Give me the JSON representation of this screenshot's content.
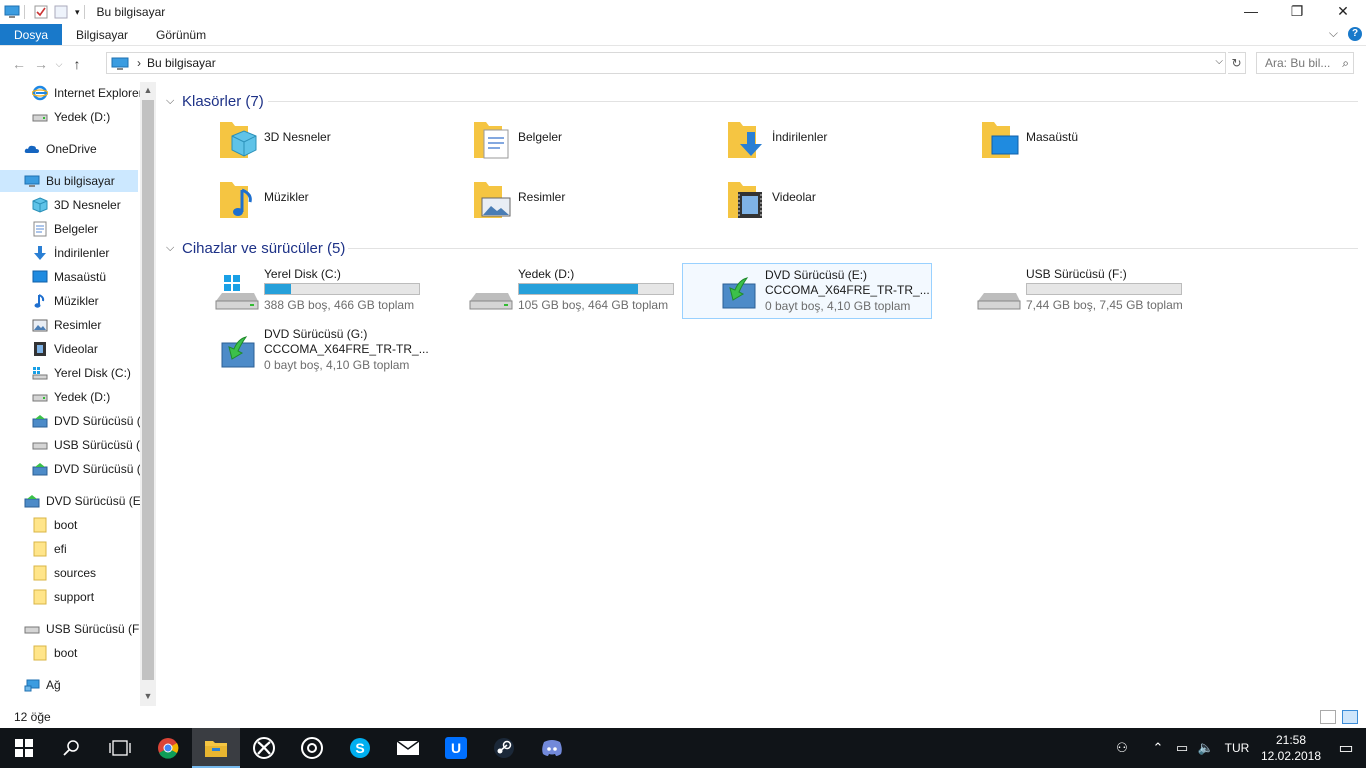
{
  "window": {
    "title": "Bu bilgisayar",
    "min_glyph": "—",
    "max_glyph": "❐",
    "close_glyph": "✕"
  },
  "ribbon": {
    "tabs": [
      "Dosya",
      "Bilgisayar",
      "Görünüm"
    ],
    "help_glyph": "?",
    "expand_glyph": "⌵"
  },
  "nav": {
    "back_glyph": "←",
    "forward_glyph": "→",
    "up_glyph": "↑",
    "recent_glyph": "⌵"
  },
  "address": {
    "path": "Bu bilgisayar",
    "sep_glyph": "›",
    "dropdown_glyph": "⌵",
    "refresh_glyph": "↻"
  },
  "search": {
    "placeholder": "Ara: Bu bil...",
    "icon_glyph": "⌕"
  },
  "sidebar": {
    "items": [
      {
        "label": "Internet Explorer",
        "icon": "internet-explorer-icon"
      },
      {
        "label": "Yedek (D:)",
        "icon": "drive-icon"
      },
      {
        "label": "OneDrive",
        "icon": "onedrive-icon"
      },
      {
        "label": "Bu bilgisayar",
        "icon": "computer-icon"
      },
      {
        "label": "3D Nesneler",
        "icon": "3d-objects-icon"
      },
      {
        "label": "Belgeler",
        "icon": "documents-icon"
      },
      {
        "label": "İndirilenler",
        "icon": "downloads-icon"
      },
      {
        "label": "Masaüstü",
        "icon": "desktop-icon"
      },
      {
        "label": "Müzikler",
        "icon": "music-icon"
      },
      {
        "label": "Resimler",
        "icon": "pictures-icon"
      },
      {
        "label": "Videolar",
        "icon": "videos-icon"
      },
      {
        "label": "Yerel Disk (C:)",
        "icon": "windows-drive-icon"
      },
      {
        "label": "Yedek (D:)",
        "icon": "drive-icon"
      },
      {
        "label": "DVD Sürücüsü (E",
        "icon": "dvd-icon"
      },
      {
        "label": "USB Sürücüsü (F",
        "icon": "usb-drive-icon"
      },
      {
        "label": "DVD Sürücüsü (G",
        "icon": "dvd-icon"
      },
      {
        "label": "DVD Sürücüsü (E:)",
        "icon": "dvd-icon"
      },
      {
        "label": "boot",
        "icon": "folder-icon"
      },
      {
        "label": "efi",
        "icon": "folder-icon"
      },
      {
        "label": "sources",
        "icon": "folder-icon"
      },
      {
        "label": "support",
        "icon": "folder-icon"
      },
      {
        "label": "USB Sürücüsü (F:)",
        "icon": "usb-drive-icon"
      },
      {
        "label": "boot",
        "icon": "folder-icon"
      },
      {
        "label": "Ağ",
        "icon": "network-icon"
      }
    ],
    "scroll_up_glyph": "▲",
    "scroll_down_glyph": "▼"
  },
  "groups": {
    "folders": {
      "title": "Klasörler (7)",
      "items": [
        {
          "name": "3D Nesneler"
        },
        {
          "name": "Belgeler"
        },
        {
          "name": "İndirilenler"
        },
        {
          "name": "Masaüstü"
        },
        {
          "name": "Müzikler"
        },
        {
          "name": "Resimler"
        },
        {
          "name": "Videolar"
        }
      ]
    },
    "drives": {
      "title": "Cihazlar ve sürücüler (5)",
      "items": [
        {
          "name": "Yerel Disk (C:)",
          "info": "388 GB boş, 466 GB toplam",
          "used_fraction": 0.167
        },
        {
          "name": "Yedek (D:)",
          "info": "105 GB boş, 464 GB toplam",
          "used_fraction": 0.774
        },
        {
          "name": "DVD Sürücüsü (E:)",
          "sub": "CCCOMA_X64FRE_TR-TR_...",
          "info": "0 bayt boş, 4,10 GB toplam"
        },
        {
          "name": "USB Sürücüsü (F:)",
          "info": "7,44 GB boş, 7,45 GB toplam",
          "used_fraction": 0.0
        },
        {
          "name": "DVD Sürücüsü (G:)",
          "sub": "CCCOMA_X64FRE_TR-TR_...",
          "info": "0 bayt boş, 4,10 GB toplam"
        }
      ]
    },
    "chevron_glyph": "⌵"
  },
  "status": {
    "count": "12 öğe"
  },
  "taskbar": {
    "apps": [
      "start-icon",
      "search-icon",
      "task-view-icon",
      "chrome-icon",
      "file-explorer-icon",
      "xbox-icon",
      "groove-music-icon",
      "skype-icon",
      "mail-icon",
      "uplay-icon",
      "steam-icon",
      "discord-icon"
    ],
    "lang": "TUR",
    "time": "21:58",
    "date": "12.02.2018"
  },
  "colors": {
    "accent": "#1979ca",
    "selection": "#cce8ff",
    "bar_fill": "#26a0da",
    "taskbar": "#101418",
    "folder": "#f5c542"
  }
}
